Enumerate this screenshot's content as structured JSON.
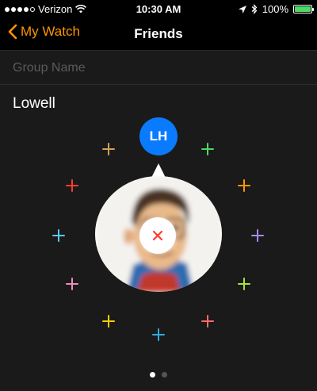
{
  "status_bar": {
    "carrier": "Verizon",
    "time": "10:30 AM",
    "battery_percent": "100%",
    "battery_level": 1.0,
    "signal_filled": 4,
    "signal_total": 5,
    "icons": [
      "wifi-icon",
      "location-arrow-icon",
      "bluetooth-icon",
      "battery-icon"
    ]
  },
  "nav": {
    "back_label": "My Watch",
    "title": "Friends",
    "accent_color": "#ff9500"
  },
  "group": {
    "placeholder": "Group Name",
    "value": ""
  },
  "contact": {
    "name": "Lowell",
    "initials": "LH",
    "initials_bg": "#0a7aff"
  },
  "friend_slots": [
    {
      "color": "#d4a05a"
    },
    {
      "color": "#4cd964"
    },
    {
      "color": "#ff3b30"
    },
    {
      "color": "#ff9500"
    },
    {
      "color": "#5ac8fa"
    },
    {
      "color": "#a78bfa"
    },
    {
      "color": "#f08cc0"
    },
    {
      "color": "#a3e635"
    },
    {
      "color": "#ffcc00"
    },
    {
      "color": "#ff6b6b"
    },
    {
      "color": "#34aadc"
    }
  ],
  "remove": {
    "icon": "close-icon",
    "color": "#ff3b30"
  },
  "pagination": {
    "total": 2,
    "current": 1
  }
}
